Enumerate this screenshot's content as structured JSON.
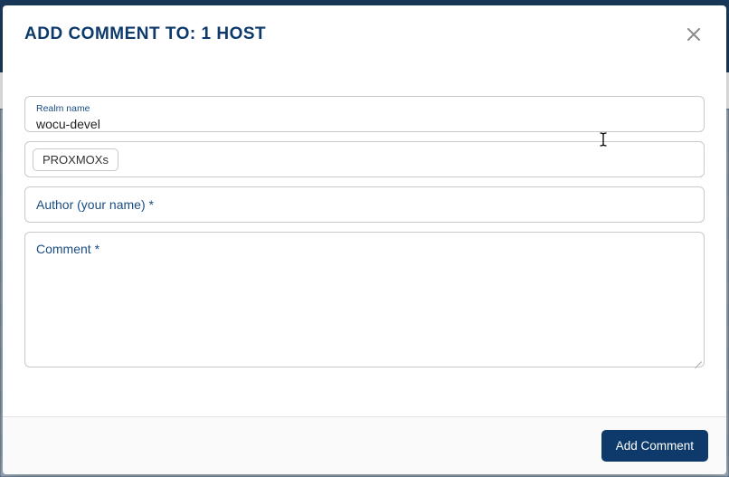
{
  "modal": {
    "title": "ADD COMMENT TO: 1 HOST",
    "realm": {
      "label": "Realm name",
      "value": "wocu-devel"
    },
    "hosts": {
      "chips": [
        "PROXMOXs"
      ]
    },
    "author": {
      "placeholder": "Author (your name) *",
      "value": ""
    },
    "comment": {
      "placeholder": "Comment *",
      "value": ""
    },
    "submit_label": "Add Comment"
  }
}
